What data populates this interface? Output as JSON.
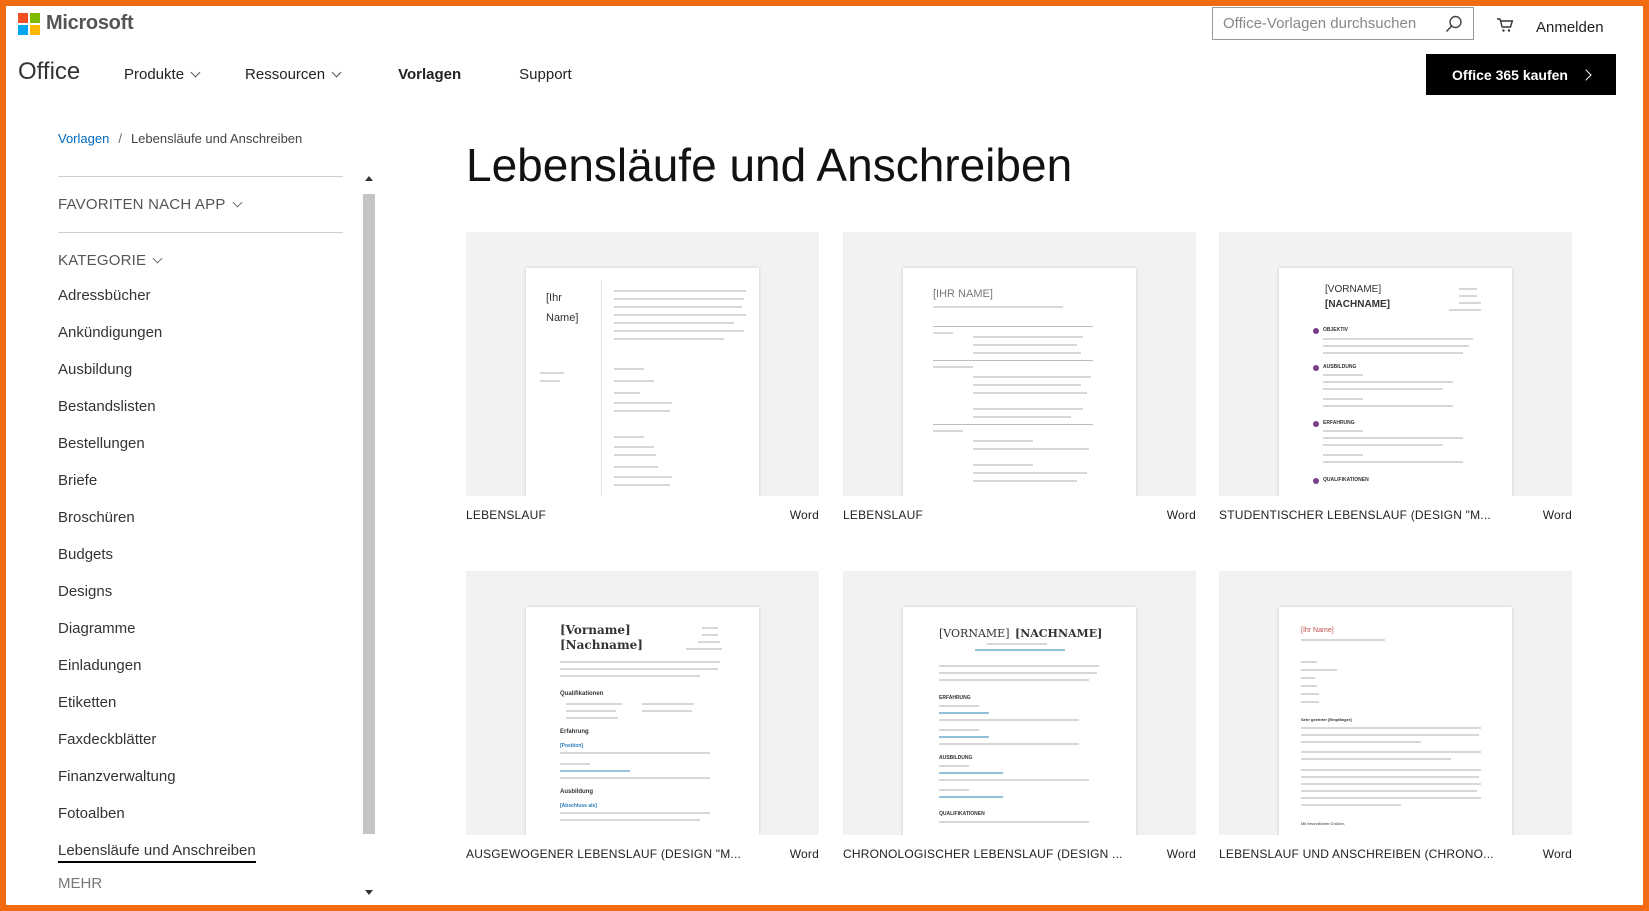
{
  "brand": {
    "logo_text": "Microsoft",
    "product": "Office",
    "logo_colors": [
      "#f25022",
      "#7fba00",
      "#00a4ef",
      "#ffb900"
    ]
  },
  "nav": [
    {
      "label": "Produkte",
      "dropdown": true
    },
    {
      "label": "Ressourcen",
      "dropdown": true
    },
    {
      "label": "Vorlagen",
      "dropdown": false
    },
    {
      "label": "Support",
      "dropdown": false
    }
  ],
  "search": {
    "placeholder": "Office-Vorlagen durchsuchen",
    "icon": "search-icon"
  },
  "header": {
    "cart_icon": "cart-icon",
    "signin": "Anmelden",
    "buy_button": "Office 365 kaufen"
  },
  "breadcrumb": {
    "root": "Vorlagen",
    "current": "Lebensläufe und Anschreiben"
  },
  "sidebar": {
    "favorites_heading": "FAVORITEN NACH APP",
    "category_heading": "KATEGORIE",
    "categories": [
      "Adressbücher",
      "Ankündigungen",
      "Ausbildung",
      "Bestandslisten",
      "Bestellungen",
      "Briefe",
      "Broschüren",
      "Budgets",
      "Designs",
      "Diagramme",
      "Einladungen",
      "Etiketten",
      "Faxdeckblätter",
      "Finanzverwaltung",
      "Fotoalben",
      "Lebensläufe und Anschreiben"
    ],
    "more": "MEHR"
  },
  "page_title": "Lebensläufe und Anschreiben",
  "templates": [
    {
      "title": "LEBENSLAUF",
      "app": "Word",
      "preview": {
        "name_lines": [
          "[Ihr",
          "Name]"
        ]
      }
    },
    {
      "title": "LEBENSLAUF",
      "app": "Word",
      "preview": {
        "name": "[IHR NAME]"
      }
    },
    {
      "title": "STUDENTISCHER LEBENSLAUF (DESIGN \"M...",
      "app": "Word",
      "preview": {
        "first": "[VORNAME]",
        "last": "[NACHNAME]",
        "sections": [
          "OBJEKTIV",
          "AUSBILDUNG",
          "ERFAHRUNG",
          "QUALIFIKATIONEN"
        ]
      }
    },
    {
      "title": "AUSGEWOGENER LEBENSLAUF (DESIGN \"M...",
      "app": "Word",
      "preview": {
        "first": "[Vorname]",
        "last": "[Nachname]",
        "sections": [
          "Qualifikationen",
          "Erfahrung",
          "Ausbildung"
        ],
        "position": "[Position]",
        "degree": "[Abschluss als]"
      }
    },
    {
      "title": "CHRONOLOGISCHER LEBENSLAUF (DESIGN ...",
      "app": "Word",
      "preview": {
        "first": "[VORNAME]",
        "last": "[NACHNAME]",
        "sections": [
          "ERFAHRUNG",
          "AUSBILDUNG",
          "QUALIFIKATIONEN"
        ]
      }
    },
    {
      "title": "LEBENSLAUF UND ANSCHREIBEN (CHRONO...",
      "app": "Word",
      "preview": {
        "name": "[Ihr Name]",
        "greeting": "Sehr geehrter [Empfänger]",
        "closing": "Mit freundlichen Grüßen,"
      }
    }
  ]
}
